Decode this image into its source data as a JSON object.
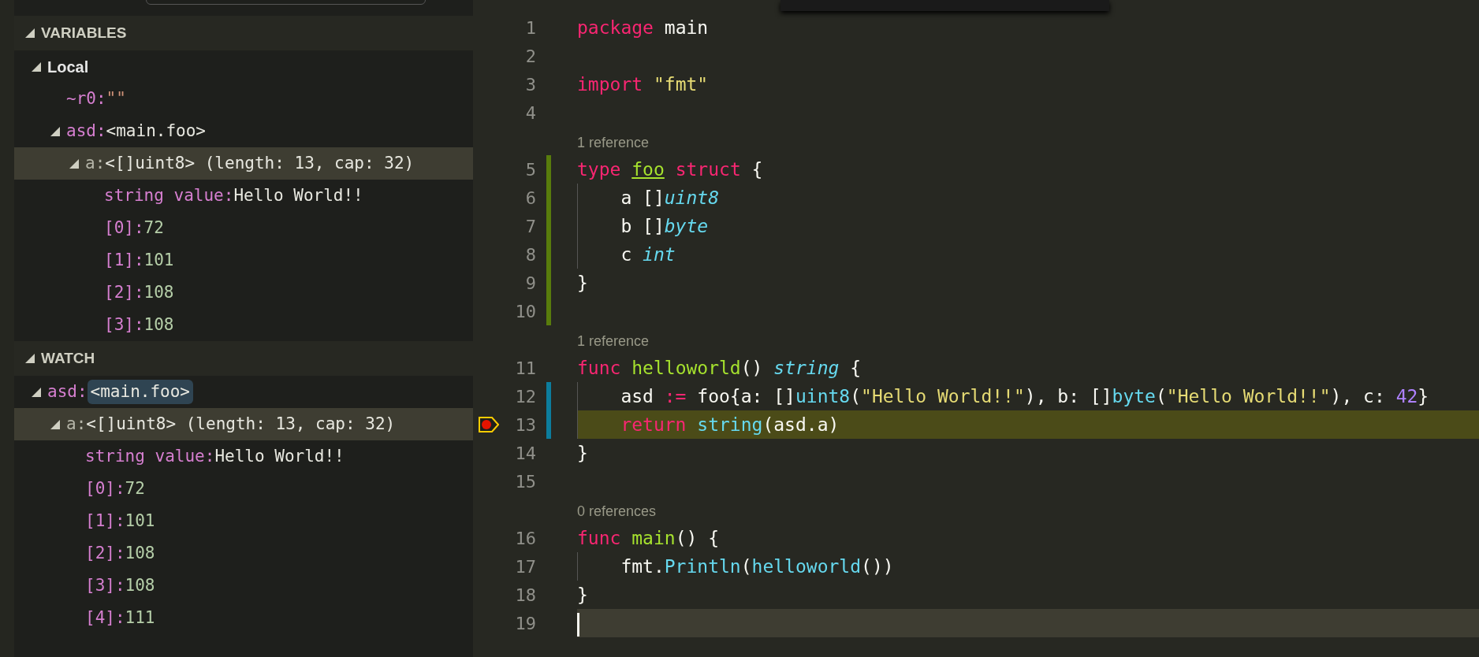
{
  "sections": [
    {
      "title": "VARIABLES",
      "expanded": true,
      "items": [
        {
          "name": "Local",
          "kind": "scope",
          "expanded": true,
          "selected": false,
          "children": [
            {
              "name": "~r0:",
              "value": "\"\"",
              "kind": "string",
              "selected": false,
              "highlighted": false
            },
            {
              "name": "asd:",
              "value": "<main.foo>",
              "kind": "type",
              "expanded": true,
              "selected": false,
              "highlighted": false,
              "children": [
                {
                  "name": "a:",
                  "value": "<[]uint8> (length: 13, cap: 32)",
                  "kind": "type",
                  "expanded": true,
                  "selected": true,
                  "highlighted": false,
                  "children": [
                    {
                      "name": "string value:",
                      "value": "Hello World!!",
                      "kind": "type",
                      "selected": false,
                      "highlighted": false
                    },
                    {
                      "name": "[0]:",
                      "value": "72",
                      "kind": "number",
                      "selected": false,
                      "highlighted": false
                    },
                    {
                      "name": "[1]:",
                      "value": "101",
                      "kind": "number",
                      "selected": false,
                      "highlighted": false
                    },
                    {
                      "name": "[2]:",
                      "value": "108",
                      "kind": "number",
                      "selected": false,
                      "highlighted": false
                    },
                    {
                      "name": "[3]:",
                      "value": "108",
                      "kind": "number",
                      "selected": false,
                      "highlighted": false
                    }
                  ]
                }
              ]
            }
          ]
        }
      ]
    },
    {
      "title": "WATCH",
      "expanded": true,
      "items": [
        {
          "name": "asd:",
          "value": "<main.foo>",
          "kind": "type",
          "expanded": true,
          "selected": false,
          "highlighted": true,
          "children": [
            {
              "name": "a:",
              "value": "<[]uint8> (length: 13, cap: 32)",
              "kind": "type",
              "expanded": true,
              "selected": true,
              "highlighted": false,
              "children": [
                {
                  "name": "string value:",
                  "value": "Hello World!!",
                  "kind": "type",
                  "selected": false,
                  "highlighted": false
                },
                {
                  "name": "[0]:",
                  "value": "72",
                  "kind": "number",
                  "selected": false,
                  "highlighted": false
                },
                {
                  "name": "[1]:",
                  "value": "101",
                  "kind": "number",
                  "selected": false,
                  "highlighted": false
                },
                {
                  "name": "[2]:",
                  "value": "108",
                  "kind": "number",
                  "selected": false,
                  "highlighted": false
                },
                {
                  "name": "[3]:",
                  "value": "108",
                  "kind": "number",
                  "selected": false,
                  "highlighted": false
                },
                {
                  "name": "[4]:",
                  "value": "111",
                  "kind": "number",
                  "selected": false,
                  "highlighted": false
                }
              ]
            }
          ]
        }
      ]
    }
  ],
  "editor": {
    "lines": [
      {
        "kind": "code",
        "number": "1",
        "breakpoint": false,
        "current": false,
        "cursor": false,
        "indented": false,
        "tokens": [
          {
            "text": "package",
            "kind": "keyword"
          },
          {
            "text": " main",
            "kind": "plain"
          }
        ]
      },
      {
        "kind": "code",
        "number": "2",
        "breakpoint": false,
        "current": false,
        "cursor": false,
        "indented": false
      },
      {
        "kind": "code",
        "number": "3",
        "breakpoint": false,
        "current": false,
        "cursor": false,
        "indented": false,
        "tokens": [
          {
            "text": "import",
            "kind": "keyword"
          },
          {
            "text": " \"fmt\"",
            "kind": "string"
          }
        ]
      },
      {
        "kind": "code",
        "number": "4",
        "breakpoint": false,
        "current": false,
        "cursor": false,
        "indented": false
      },
      {
        "kind": "lens",
        "text": "1 reference"
      },
      {
        "kind": "code",
        "number": "5",
        "added": true,
        "breakpoint": false,
        "current": false,
        "cursor": false,
        "indented": false,
        "tokens": [
          {
            "text": "type ",
            "kind": "keyword"
          },
          {
            "text": "foo",
            "kind": "definition"
          },
          {
            "text": " struct",
            "kind": "keyword"
          },
          {
            "text": " {",
            "kind": "plain"
          }
        ]
      },
      {
        "kind": "code",
        "number": "6",
        "added": true,
        "breakpoint": false,
        "current": false,
        "cursor": false,
        "indented": true,
        "tokens": [
          {
            "text": "a []",
            "kind": "plain"
          },
          {
            "text": "uint8",
            "kind": "type_italic"
          }
        ]
      },
      {
        "kind": "code",
        "number": "7",
        "added": true,
        "breakpoint": false,
        "current": false,
        "cursor": false,
        "indented": true,
        "tokens": [
          {
            "text": "b []",
            "kind": "plain"
          },
          {
            "text": "byte",
            "kind": "type_italic"
          }
        ]
      },
      {
        "kind": "code",
        "number": "8",
        "added": true,
        "breakpoint": false,
        "current": false,
        "cursor": false,
        "indented": true,
        "tokens": [
          {
            "text": "c ",
            "kind": "plain"
          },
          {
            "text": "int",
            "kind": "type_italic"
          }
        ]
      },
      {
        "kind": "code",
        "number": "9",
        "added": true,
        "breakpoint": false,
        "current": false,
        "cursor": false,
        "indented": false,
        "tokens": [
          {
            "text": "}",
            "kind": "plain"
          }
        ]
      },
      {
        "kind": "code",
        "number": "10",
        "added": true,
        "breakpoint": false,
        "current": false,
        "cursor": false,
        "indented": false
      },
      {
        "kind": "lens",
        "text": "1 reference"
      },
      {
        "kind": "code",
        "number": "11",
        "breakpoint": false,
        "current": false,
        "cursor": false,
        "indented": false,
        "tokens": [
          {
            "text": "func ",
            "kind": "keyword"
          },
          {
            "text": "helloworld",
            "kind": "function"
          },
          {
            "text": "() ",
            "kind": "plain"
          },
          {
            "text": "string",
            "kind": "type_italic"
          },
          {
            "text": " {",
            "kind": "plain"
          }
        ]
      },
      {
        "kind": "code",
        "number": "12",
        "modified": true,
        "breakpoint": false,
        "current": false,
        "cursor": false,
        "indented": true,
        "tokens": [
          {
            "text": "asd ",
            "kind": "plain"
          },
          {
            "text": ":=",
            "kind": "keyword"
          },
          {
            "text": " foo{a: []",
            "kind": "plain"
          },
          {
            "text": "uint8",
            "kind": "call"
          },
          {
            "text": "(",
            "kind": "plain"
          },
          {
            "text": "\"Hello World!!\"",
            "kind": "string"
          },
          {
            "text": "), b: []",
            "kind": "plain"
          },
          {
            "text": "byte",
            "kind": "call"
          },
          {
            "text": "(",
            "kind": "plain"
          },
          {
            "text": "\"Hello World!!\"",
            "kind": "string"
          },
          {
            "text": "), c: ",
            "kind": "plain"
          },
          {
            "text": "42",
            "kind": "number"
          },
          {
            "text": "}",
            "kind": "plain"
          }
        ]
      },
      {
        "kind": "code",
        "number": "13",
        "modified": true,
        "breakpoint": true,
        "current": true,
        "cursor": false,
        "indented": true,
        "tokens": [
          {
            "text": "return ",
            "kind": "keyword"
          },
          {
            "text": "string",
            "kind": "call"
          },
          {
            "text": "(asd.a)",
            "kind": "plain"
          }
        ]
      },
      {
        "kind": "code",
        "number": "14",
        "breakpoint": false,
        "current": false,
        "cursor": false,
        "indented": false,
        "tokens": [
          {
            "text": "}",
            "kind": "plain"
          }
        ]
      },
      {
        "kind": "code",
        "number": "15",
        "breakpoint": false,
        "current": false,
        "cursor": false,
        "indented": false
      },
      {
        "kind": "lens",
        "text": "0 references"
      },
      {
        "kind": "code",
        "number": "16",
        "breakpoint": false,
        "current": false,
        "cursor": false,
        "indented": false,
        "tokens": [
          {
            "text": "func ",
            "kind": "keyword"
          },
          {
            "text": "main",
            "kind": "function"
          },
          {
            "text": "() {",
            "kind": "plain"
          }
        ]
      },
      {
        "kind": "code",
        "number": "17",
        "breakpoint": false,
        "current": false,
        "cursor": false,
        "indented": true,
        "tokens": [
          {
            "text": "fmt.",
            "kind": "plain"
          },
          {
            "text": "Println",
            "kind": "call"
          },
          {
            "text": "(",
            "kind": "plain"
          },
          {
            "text": "helloworld",
            "kind": "call"
          },
          {
            "text": "())",
            "kind": "plain"
          }
        ]
      },
      {
        "kind": "code",
        "number": "18",
        "breakpoint": false,
        "current": false,
        "cursor": false,
        "indented": false,
        "tokens": [
          {
            "text": "}",
            "kind": "plain"
          }
        ]
      },
      {
        "kind": "code",
        "number": "19",
        "breakpoint": false,
        "current": false,
        "cursor": true,
        "indented": false
      }
    ]
  }
}
